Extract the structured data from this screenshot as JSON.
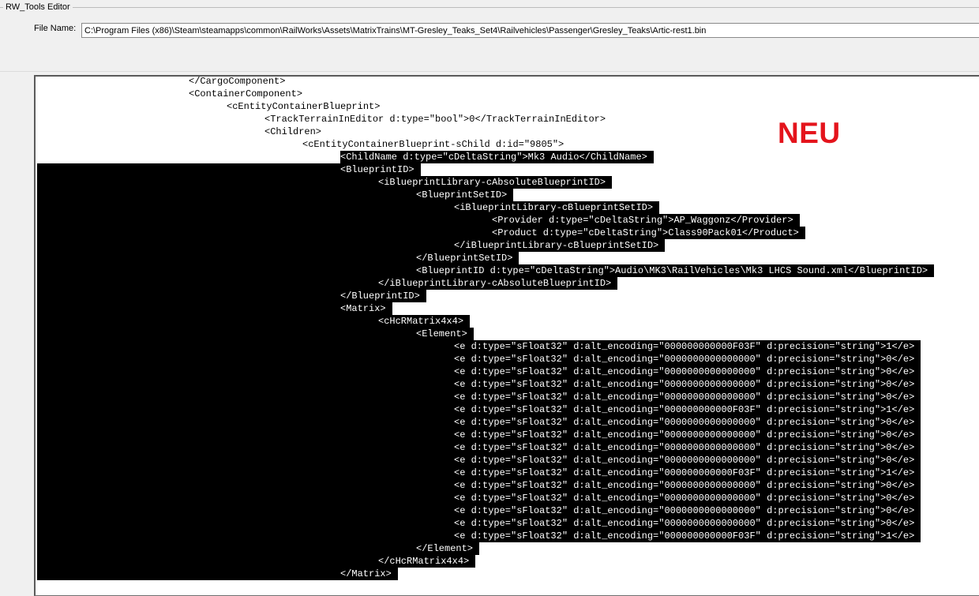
{
  "window": {
    "group_title": "RW_Tools Editor",
    "file_label": "File Name:",
    "file_path": "C:\\Program Files (x86)\\Steam\\steamapps\\common\\RailWorks\\Assets\\MatrixTrains\\MT-Gresley_Teaks_Set4\\Railvehicles\\Passenger\\Gresley_Teaks\\Artic-rest1.bin"
  },
  "annotation": {
    "text": "NEU",
    "color": "#e4141c"
  },
  "editor": {
    "lines": [
      {
        "indent": 4,
        "text": "</CargoComponent>",
        "selected": false
      },
      {
        "indent": 4,
        "text": "<ContainerComponent>",
        "selected": false
      },
      {
        "indent": 5,
        "text": "<cEntityContainerBlueprint>",
        "selected": false
      },
      {
        "indent": 6,
        "text": "<TrackTerrainInEditor d:type=\"bool\">0</TrackTerrainInEditor>",
        "selected": false
      },
      {
        "indent": 6,
        "text": "<Children>",
        "selected": false
      },
      {
        "indent": 7,
        "text": "<cEntityContainerBlueprint-sChild d:id=\"9805\">",
        "selected": false
      },
      {
        "indent": 8,
        "text": "<ChildName d:type=\"cDeltaString\">Mk3 Audio</ChildName>",
        "selected": true
      },
      {
        "indent": 8,
        "text": "<BlueprintID>",
        "selected": true
      },
      {
        "indent": 9,
        "text": "<iBlueprintLibrary-cAbsoluteBlueprintID>",
        "selected": true
      },
      {
        "indent": 10,
        "text": "<BlueprintSetID>",
        "selected": true
      },
      {
        "indent": 11,
        "text": "<iBlueprintLibrary-cBlueprintSetID>",
        "selected": true
      },
      {
        "indent": 12,
        "text": "<Provider d:type=\"cDeltaString\">AP_Waggonz</Provider>",
        "selected": true
      },
      {
        "indent": 12,
        "text": "<Product d:type=\"cDeltaString\">Class90Pack01</Product>",
        "selected": true
      },
      {
        "indent": 11,
        "text": "</iBlueprintLibrary-cBlueprintSetID>",
        "selected": true
      },
      {
        "indent": 10,
        "text": "</BlueprintSetID>",
        "selected": true
      },
      {
        "indent": 10,
        "text": "<BlueprintID d:type=\"cDeltaString\">Audio\\MK3\\RailVehicles\\Mk3 LHCS Sound.xml</BlueprintID>",
        "selected": true
      },
      {
        "indent": 9,
        "text": "</iBlueprintLibrary-cAbsoluteBlueprintID>",
        "selected": true
      },
      {
        "indent": 8,
        "text": "</BlueprintID>",
        "selected": true
      },
      {
        "indent": 8,
        "text": "<Matrix>",
        "selected": true
      },
      {
        "indent": 9,
        "text": "<cHcRMatrix4x4>",
        "selected": true
      },
      {
        "indent": 10,
        "text": "<Element>",
        "selected": true
      },
      {
        "indent": 11,
        "text": "<e d:type=\"sFloat32\" d:alt_encoding=\"000000000000F03F\" d:precision=\"string\">1</e>",
        "selected": true
      },
      {
        "indent": 11,
        "text": "<e d:type=\"sFloat32\" d:alt_encoding=\"0000000000000000\" d:precision=\"string\">0</e>",
        "selected": true
      },
      {
        "indent": 11,
        "text": "<e d:type=\"sFloat32\" d:alt_encoding=\"0000000000000000\" d:precision=\"string\">0</e>",
        "selected": true
      },
      {
        "indent": 11,
        "text": "<e d:type=\"sFloat32\" d:alt_encoding=\"0000000000000000\" d:precision=\"string\">0</e>",
        "selected": true
      },
      {
        "indent": 11,
        "text": "<e d:type=\"sFloat32\" d:alt_encoding=\"0000000000000000\" d:precision=\"string\">0</e>",
        "selected": true
      },
      {
        "indent": 11,
        "text": "<e d:type=\"sFloat32\" d:alt_encoding=\"000000000000F03F\" d:precision=\"string\">1</e>",
        "selected": true
      },
      {
        "indent": 11,
        "text": "<e d:type=\"sFloat32\" d:alt_encoding=\"0000000000000000\" d:precision=\"string\">0</e>",
        "selected": true
      },
      {
        "indent": 11,
        "text": "<e d:type=\"sFloat32\" d:alt_encoding=\"0000000000000000\" d:precision=\"string\">0</e>",
        "selected": true
      },
      {
        "indent": 11,
        "text": "<e d:type=\"sFloat32\" d:alt_encoding=\"0000000000000000\" d:precision=\"string\">0</e>",
        "selected": true
      },
      {
        "indent": 11,
        "text": "<e d:type=\"sFloat32\" d:alt_encoding=\"0000000000000000\" d:precision=\"string\">0</e>",
        "selected": true
      },
      {
        "indent": 11,
        "text": "<e d:type=\"sFloat32\" d:alt_encoding=\"000000000000F03F\" d:precision=\"string\">1</e>",
        "selected": true
      },
      {
        "indent": 11,
        "text": "<e d:type=\"sFloat32\" d:alt_encoding=\"0000000000000000\" d:precision=\"string\">0</e>",
        "selected": true
      },
      {
        "indent": 11,
        "text": "<e d:type=\"sFloat32\" d:alt_encoding=\"0000000000000000\" d:precision=\"string\">0</e>",
        "selected": true
      },
      {
        "indent": 11,
        "text": "<e d:type=\"sFloat32\" d:alt_encoding=\"0000000000000000\" d:precision=\"string\">0</e>",
        "selected": true
      },
      {
        "indent": 11,
        "text": "<e d:type=\"sFloat32\" d:alt_encoding=\"0000000000000000\" d:precision=\"string\">0</e>",
        "selected": true
      },
      {
        "indent": 11,
        "text": "<e d:type=\"sFloat32\" d:alt_encoding=\"000000000000F03F\" d:precision=\"string\">1</e>",
        "selected": true
      },
      {
        "indent": 10,
        "text": "</Element>",
        "selected": true
      },
      {
        "indent": 9,
        "text": "</cHcRMatrix4x4>",
        "selected": true
      },
      {
        "indent": 8,
        "text": "</Matrix>",
        "selected": true
      }
    ]
  }
}
